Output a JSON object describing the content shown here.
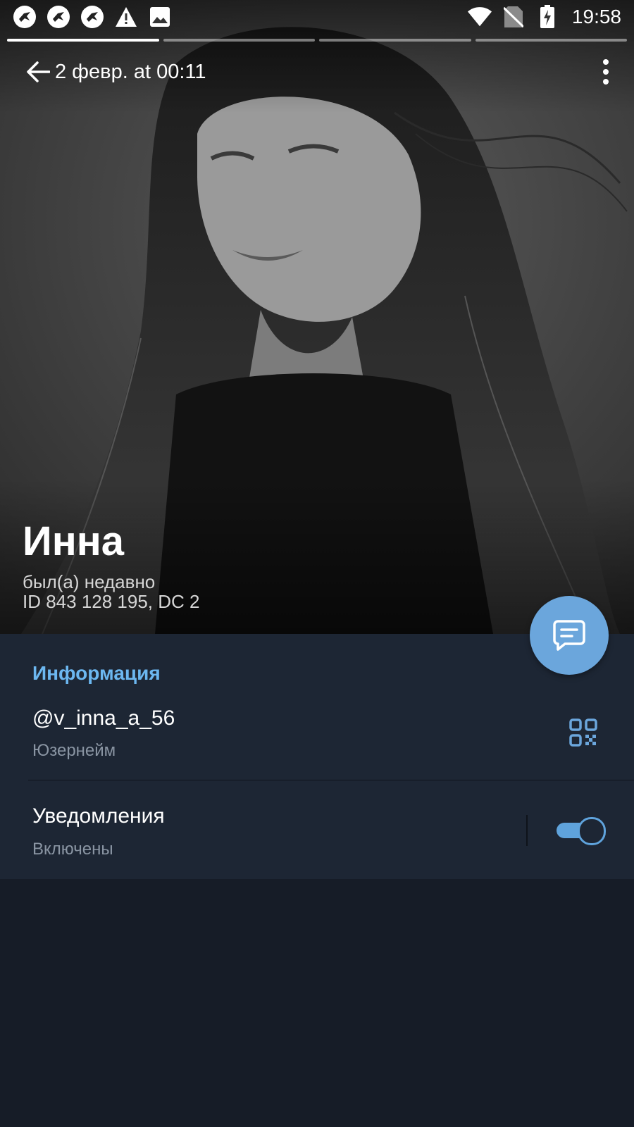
{
  "statusbar": {
    "left_icons": [
      "bird-notification-icon",
      "bird-notification-icon",
      "bird-notification-icon",
      "warning-icon",
      "image-icon"
    ],
    "right_icons": [
      "wifi-icon",
      "no-sim-icon",
      "battery-charging-icon"
    ],
    "time": "19:58"
  },
  "stories": {
    "segments": 4,
    "active_index": 0
  },
  "appbar": {
    "title": "2 февр. at 00:11"
  },
  "profile": {
    "name": "Инна",
    "status": "был(а) недавно",
    "id_line": "ID 843 128 195, DC 2"
  },
  "info": {
    "section_title": "Информация",
    "username": "@v_inna_a_56",
    "username_label": "Юзернейм",
    "notifications_title": "Уведомления",
    "notifications_state": "Включены"
  },
  "colors": {
    "accent": "#6ba6dc",
    "section_title": "#6cb7f0",
    "panel_bg": "#1d2634",
    "page_bg": "#161c27"
  }
}
